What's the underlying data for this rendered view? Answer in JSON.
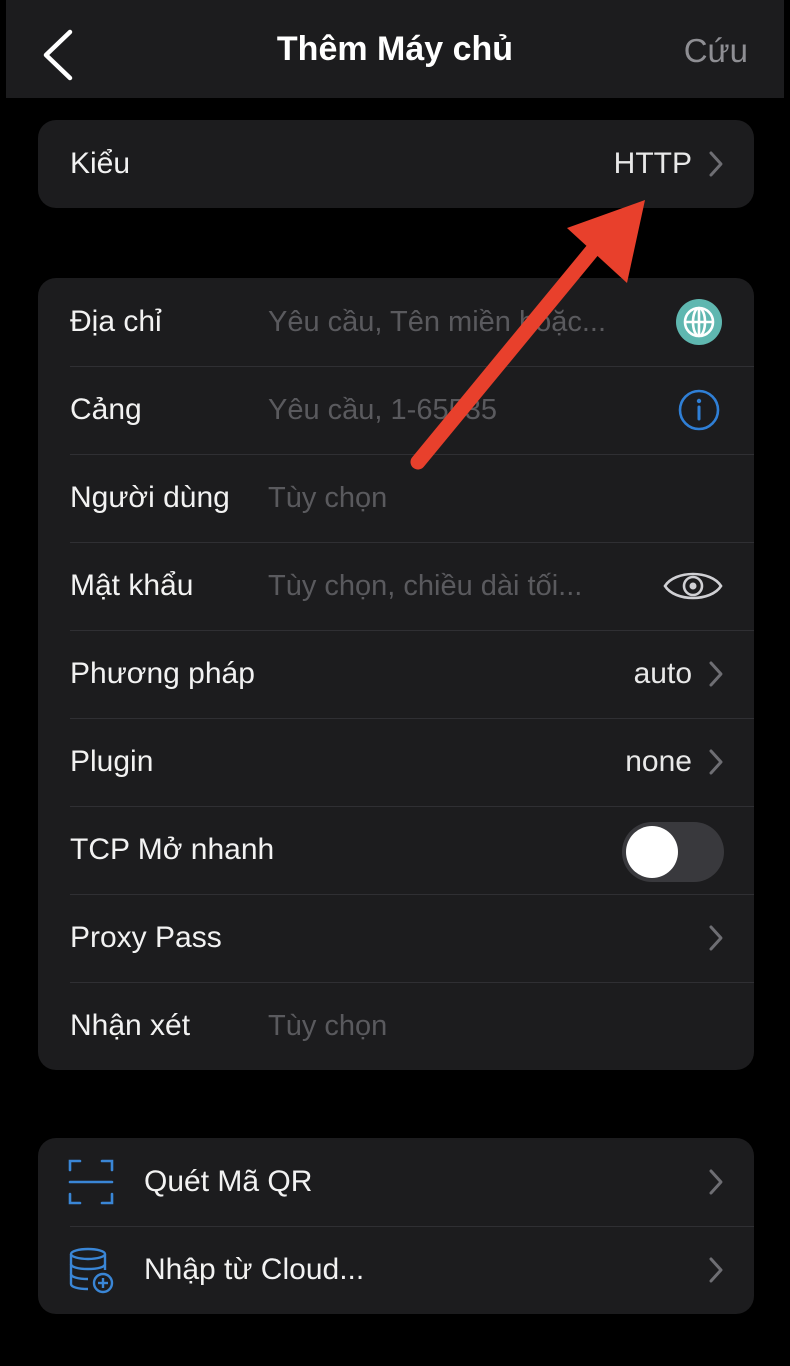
{
  "nav": {
    "title": "Thêm Máy chủ",
    "save_label": "Cứu"
  },
  "type_row": {
    "label": "Kiểu",
    "value": "HTTP"
  },
  "form": {
    "address": {
      "label": "Địa chỉ",
      "placeholder": "Yêu cầu, Tên miền hoặc..."
    },
    "port": {
      "label": "Cảng",
      "placeholder": "Yêu cầu, 1-65535"
    },
    "user": {
      "label": "Người dùng",
      "placeholder": "Tùy chọn"
    },
    "password": {
      "label": "Mật khẩu",
      "placeholder": "Tùy chọn, chiều dài tối..."
    },
    "method": {
      "label": "Phương pháp",
      "value": "auto"
    },
    "plugin": {
      "label": "Plugin",
      "value": "none"
    },
    "tcp_fast_open": {
      "label": "TCP Mở nhanh",
      "enabled": false
    },
    "proxy_pass": {
      "label": "Proxy Pass"
    },
    "comment": {
      "label": "Nhận xét",
      "placeholder": "Tùy chọn"
    }
  },
  "actions": {
    "scan_qr": {
      "label": "Quét Mã QR",
      "icon": "qr-scan-icon"
    },
    "import_cloud": {
      "label": "Nhập từ Cloud...",
      "icon": "database-add-icon"
    }
  },
  "colors": {
    "background": "#000000",
    "cell": "#1c1c1e",
    "globe_badge": "#5fb7b0",
    "info_icon": "#2f7fd6",
    "annotation_arrow": "#e8402c"
  }
}
